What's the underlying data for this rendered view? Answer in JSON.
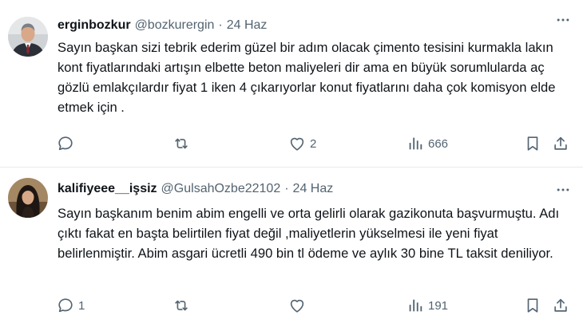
{
  "tweets": [
    {
      "display_name": "erginbozkur",
      "handle": "@bozkurergin",
      "separator": "·",
      "date": "24 Haz",
      "avatar_icon": "avatar-man-suit",
      "text": "Sayın başkan sizi tebrik ederim güzel bir adım olacak çimento tesisini kurmakla lakın kont fiyatlarındaki artışın elbette beton maliyeleri dir ama en büyük sorumlularda aç gözlü emlakçılardır fiyat 1 iken 4 çıkarıyorlar konut fiyatlarını daha çok komisyon elde etmek için .",
      "replies": "",
      "retweets": "",
      "likes": "2",
      "views": "666"
    },
    {
      "display_name": "kalifiyeee__işsiz",
      "handle": "@GulsahOzbe22102",
      "separator": "·",
      "date": "24 Haz",
      "avatar_icon": "avatar-woman-dark-hair",
      "text": "Sayın başkanım benim abim engelli ve orta gelirli olarak gazikonuta başvurmuştu. Adı çıktı fakat en başta belirtilen fiyat değil ,maliyetlerin yükselmesi ile yeni fiyat belirlenmiştir. Abim asgari ücretli 490 bin tl ödeme ve aylık 30 bine TL taksit deniliyor.",
      "replies": "1",
      "retweets": "",
      "likes": "",
      "views": "191"
    }
  ],
  "colors": {
    "text_primary": "#0f1419",
    "text_secondary": "#536471",
    "divider": "#e6e9ec",
    "background": "#ffffff"
  },
  "icons": [
    "more-icon",
    "reply-icon",
    "retweet-icon",
    "like-icon",
    "views-icon",
    "bookmark-icon",
    "share-icon"
  ]
}
